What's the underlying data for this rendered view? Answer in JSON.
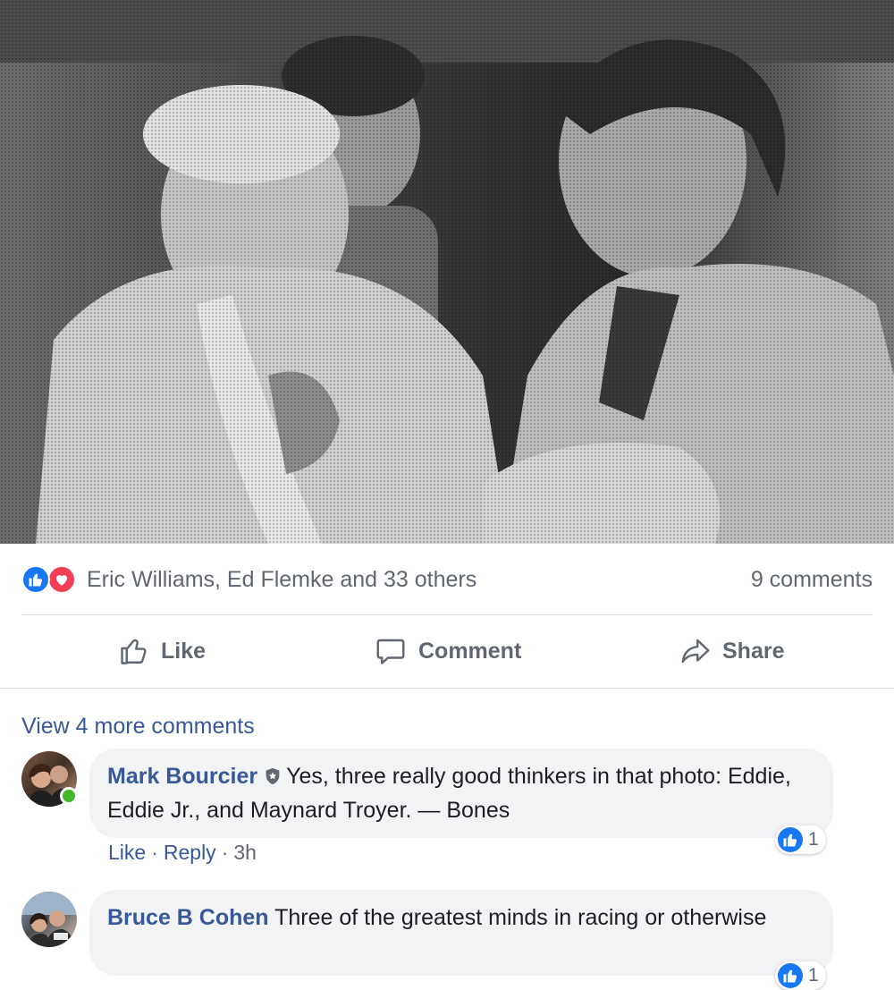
{
  "photo": {
    "icon": "photo-image"
  },
  "summary": {
    "reactions": [
      "like-icon",
      "love-icon"
    ],
    "names": "Eric Williams, Ed Flemke and 33 others",
    "comment_count": "9 comments"
  },
  "actions": {
    "like_label": "Like",
    "comment_label": "Comment",
    "share_label": "Share"
  },
  "comments_section": {
    "view_more": "View 4 more comments",
    "comments": [
      {
        "author": "Mark Bourcier",
        "text": "Yes, three really good thinkers in that photo: Eddie, Eddie Jr., and Maynard Troyer. — Bones",
        "like_action": "Like",
        "reply_action": "Reply",
        "time": "3h",
        "reaction_count": "1"
      },
      {
        "author": "Bruce B Cohen",
        "text": "Three of the greatest minds in racing or otherwise",
        "reaction_count": "1"
      }
    ]
  },
  "colors": {
    "link_blue": "#385898",
    "like_blue": "#1877f2",
    "love_red": "#f33e58",
    "bubble_gray": "#f2f3f5",
    "muted_text": "#606770",
    "online_green": "#42b72a"
  }
}
